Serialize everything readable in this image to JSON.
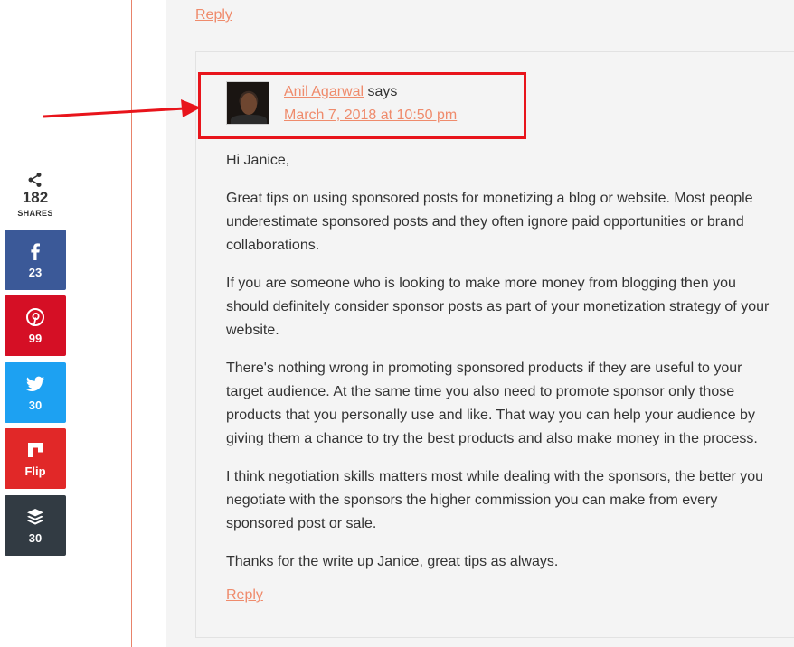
{
  "share_bar": {
    "total": "182",
    "total_label": "SHARES",
    "buttons": [
      {
        "network": "facebook",
        "icon": "facebook-icon",
        "count": "23",
        "color": "#3b5998"
      },
      {
        "network": "pinterest",
        "icon": "pinterest-icon",
        "count": "99",
        "color": "#d50f25"
      },
      {
        "network": "twitter",
        "icon": "twitter-icon",
        "count": "30",
        "color": "#1da1f2"
      },
      {
        "network": "flipboard",
        "icon": "flipboard-icon",
        "count": "Flip",
        "color": "#e12828"
      },
      {
        "network": "buffer",
        "icon": "buffer-icon",
        "count": "30",
        "color": "#323b43"
      }
    ]
  },
  "parent_comment": {
    "reply_label": "Reply"
  },
  "comment": {
    "author": "Anil Agarwal",
    "says": "says",
    "date": "March 7, 2018 at 10:50 pm",
    "paragraphs": [
      "Hi Janice,",
      "Great tips on using sponsored posts for monetizing a blog or website. Most people underestimate sponsored posts and they often ignore paid opportunities or brand collaborations.",
      "If you are someone who is looking to make more money from blogging then you should definitely consider sponsor posts as part of your monetization strategy of your website.",
      "There's nothing wrong in promoting sponsored products if they are useful to your target audience. At the same time you also need to promote sponsor only those products that you personally use and like. That way you can help your audience by giving them a chance to try the best products and also make money in the process.",
      "I think negotiation skills matters most while dealing with the sponsors, the better you negotiate with the sponsors the higher commission you can make from every sponsored post or sale.",
      "Thanks for the write up Janice, great tips as always."
    ],
    "reply_label": "Reply"
  },
  "colors": {
    "link": "#ef8b6c",
    "annotation_red": "#e8141b"
  }
}
